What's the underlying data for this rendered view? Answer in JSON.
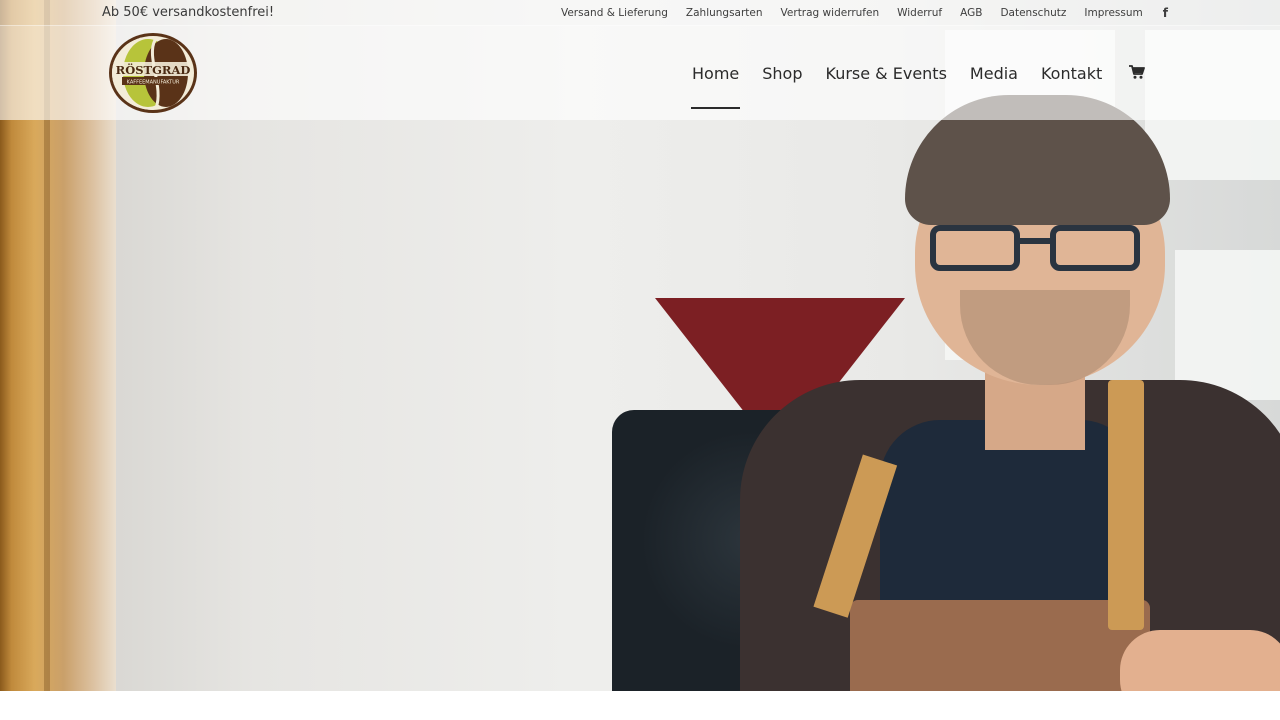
{
  "topbar": {
    "promo": "Ab 50€ versandkostenfrei!",
    "links": [
      {
        "label": "Versand & Lieferung"
      },
      {
        "label": "Zahlungsarten"
      },
      {
        "label": "Vertrag widerrufen"
      },
      {
        "label": "Widerruf"
      },
      {
        "label": "AGB"
      },
      {
        "label": "Datenschutz"
      },
      {
        "label": "Impressum"
      }
    ],
    "social_icon": "facebook-icon",
    "social_glyph": "f"
  },
  "header": {
    "logo": {
      "name": "rostgrad-logo",
      "text_main": "RÖSTGRAD",
      "text_sub": "KAFFEEMANUFAKTUR"
    },
    "nav": [
      {
        "label": "Home",
        "active": true
      },
      {
        "label": "Shop",
        "active": false
      },
      {
        "label": "Kurse & Events",
        "active": false
      },
      {
        "label": "Media",
        "active": false
      },
      {
        "label": "Kontakt",
        "active": false
      }
    ],
    "cart_icon": "shopping-cart-icon"
  },
  "colors": {
    "logo_brown": "#5a3318",
    "logo_green": "#b7c43a",
    "text": "#2b2b2b"
  }
}
